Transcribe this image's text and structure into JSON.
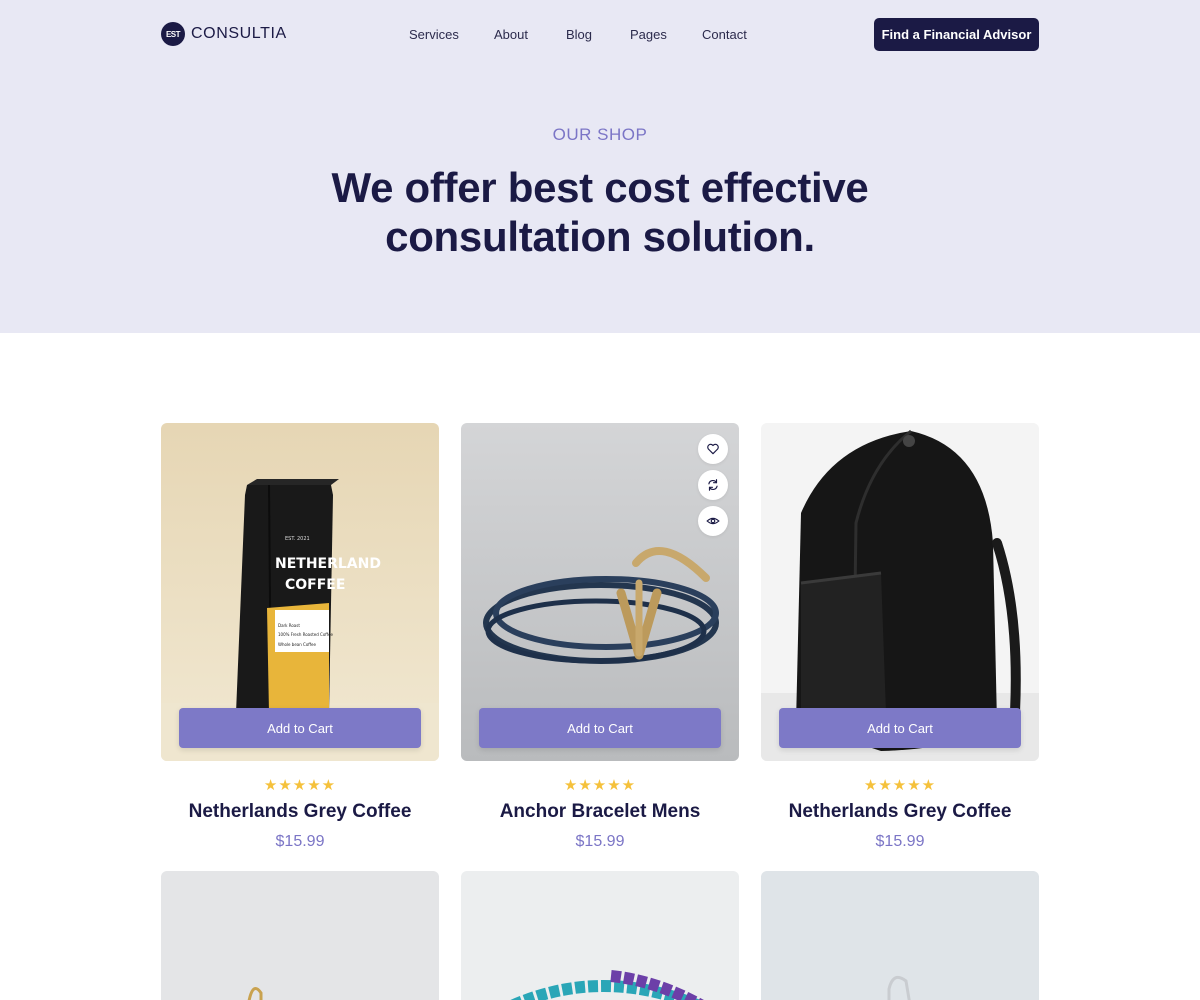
{
  "brand": {
    "name": "CONSULTIA",
    "mark_text": "EST"
  },
  "nav": [
    "Services",
    "About",
    "Blog",
    "Pages",
    "Contact"
  ],
  "cta_label": "Find a Financial Advisor",
  "hero": {
    "eyebrow": "OUR SHOP",
    "title": "We offer best cost effective consultation solution."
  },
  "products": [
    {
      "name": "Netherlands Grey Coffee",
      "price": "$15.99",
      "rating": 5,
      "button": "Add to Cart",
      "package_text": {
        "est": "EST. 2021",
        "line1": "NETHERLAND",
        "line2": "COFFEE",
        "label1": "Dark Roast",
        "label2": "100% Fresh Roasted Coffee",
        "label3": "Whole bean Coffee"
      }
    },
    {
      "name": "Anchor Bracelet Mens",
      "price": "$15.99",
      "rating": 5,
      "button": "Add to Cart"
    },
    {
      "name": "Netherlands Grey Coffee",
      "price": "$15.99",
      "rating": 5,
      "button": "Add to Cart"
    }
  ],
  "stars_text": "★★★★★",
  "card_actions": [
    "heart-icon",
    "compare-icon",
    "eye-icon"
  ],
  "colors": {
    "navy": "#1b1a45",
    "accent": "#7d79c7",
    "hero_bg": "#e8e8f4",
    "star": "#f5c13b"
  }
}
